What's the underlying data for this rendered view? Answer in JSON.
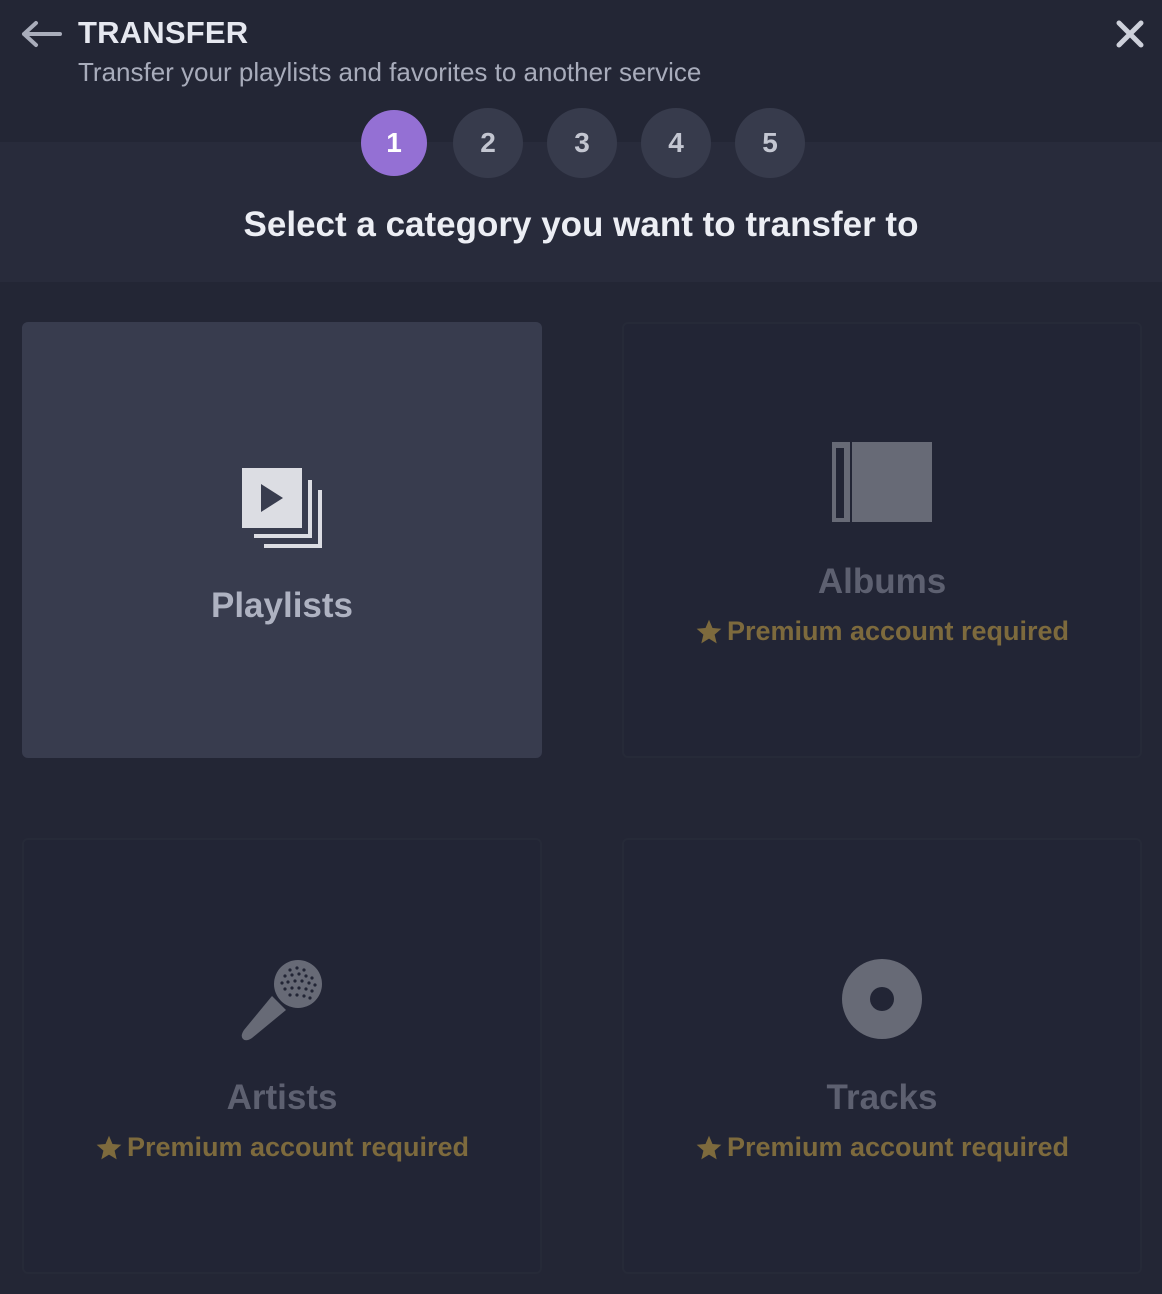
{
  "header": {
    "title": "TRANSFER",
    "subtitle": "Transfer your playlists and favorites to another service",
    "back_icon": "arrow-left-icon",
    "close_icon": "close-icon"
  },
  "stepper": {
    "active_step": 1,
    "steps": [
      "1",
      "2",
      "3",
      "4",
      "5"
    ]
  },
  "prompt": "Select a category you want to transfer to",
  "categories": [
    {
      "label": "Playlists",
      "icon": "playlist-icon",
      "selected": true,
      "premium_note": ""
    },
    {
      "label": "Albums",
      "icon": "album-icon",
      "selected": false,
      "premium_note": "Premium account required"
    },
    {
      "label": "Artists",
      "icon": "microphone-icon",
      "selected": false,
      "premium_note": "Premium account required"
    },
    {
      "label": "Tracks",
      "icon": "disc-icon",
      "selected": false,
      "premium_note": "Premium account required"
    }
  ],
  "colors": {
    "background": "#232635",
    "accent": "#9470d4",
    "premium": "#7d6a3d",
    "selected_card": "#383c4e"
  }
}
